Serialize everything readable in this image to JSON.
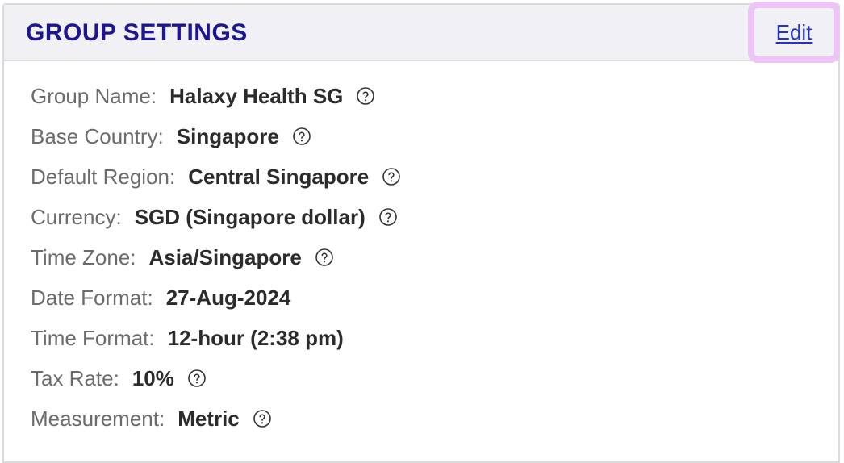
{
  "header": {
    "title": "GROUP SETTINGS",
    "edit_label": "Edit"
  },
  "settings": [
    {
      "label": "Group Name:",
      "value": "Halaxy Health SG",
      "help_icon": "question-circle-icon",
      "has_help": true
    },
    {
      "label": "Base Country:",
      "value": "Singapore",
      "help_icon": "question-circle-icon",
      "has_help": true
    },
    {
      "label": "Default Region:",
      "value": "Central Singapore",
      "help_icon": "question-circle-icon",
      "has_help": true
    },
    {
      "label": "Currency:",
      "value": "SGD (Singapore dollar)",
      "help_icon": "question-circle-icon",
      "has_help": true
    },
    {
      "label": "Time Zone:",
      "value": "Asia/Singapore",
      "help_icon": "question-circle-icon",
      "has_help": true
    },
    {
      "label": "Date Format:",
      "value": "27-Aug-2024",
      "has_help": false
    },
    {
      "label": "Time Format:",
      "value": "12-hour (2:38 pm)",
      "has_help": false
    },
    {
      "label": "Tax Rate:",
      "value": "10%",
      "help_icon": "question-circle-icon",
      "has_help": true
    },
    {
      "label": "Measurement:",
      "value": "Metric",
      "help_icon": "question-circle-icon",
      "has_help": true
    }
  ],
  "colors": {
    "title": "#1d1591",
    "link": "#2233cc",
    "highlight": "#efc3f7",
    "header_bg": "#f1f1f5",
    "label": "#6b6b6b",
    "value": "#2b2b2b"
  }
}
